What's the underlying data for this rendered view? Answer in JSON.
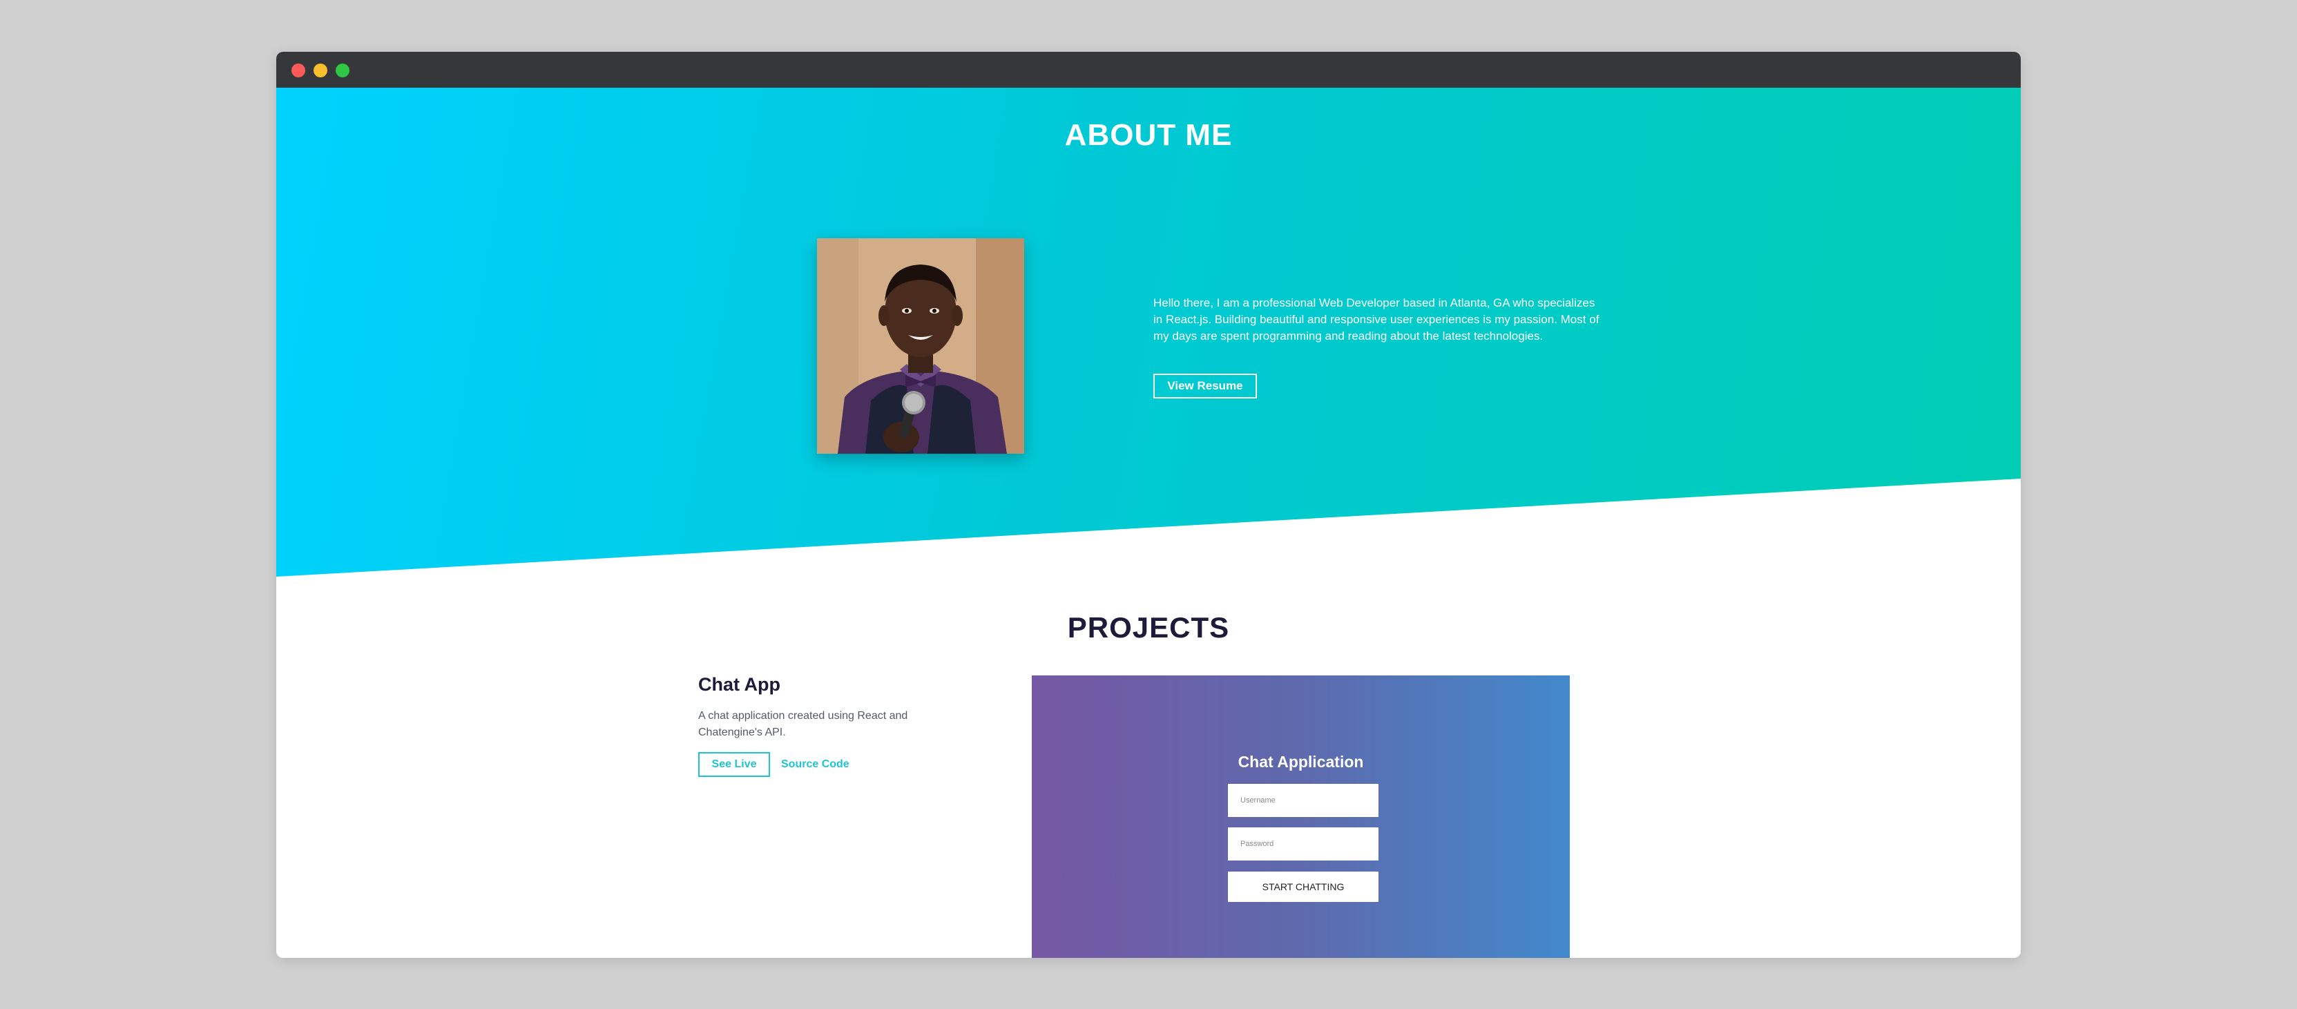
{
  "window": {
    "controls": [
      "close",
      "minimize",
      "maximize"
    ]
  },
  "about": {
    "title": "ABOUT ME",
    "bio": "Hello there, I am a professional Web Developer based in Atlanta, GA who specializes in React.js. Building beautiful and responsive user experiences is my passion. Most of my days are spent programming and reading about the latest technologies.",
    "resume_button": "View Resume",
    "colors": {
      "gradient_start": "#00d2ff",
      "gradient_end": "#00cdb4"
    }
  },
  "projects": {
    "title": "PROJECTS",
    "items": [
      {
        "name": "Chat App",
        "description": "A chat application created using React and Chatengine's API.",
        "see_live_label": "See Live",
        "source_label": "Source Code",
        "preview": {
          "title": "Chat Application",
          "username_placeholder": "Username",
          "password_placeholder": "Password",
          "button_label": "START CHATTING"
        }
      }
    ],
    "colors": {
      "accent": "#1ec4d2",
      "heading": "#1e1b3a"
    }
  }
}
